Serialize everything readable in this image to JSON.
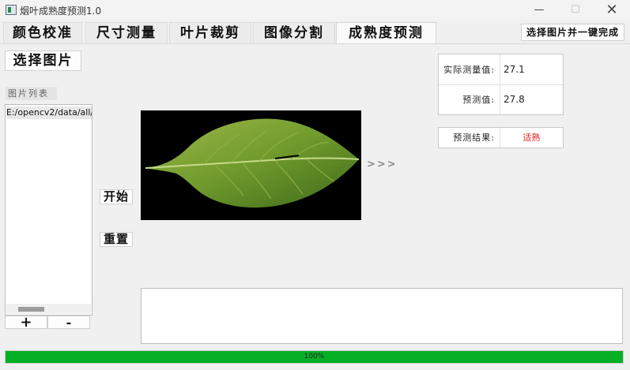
{
  "window": {
    "title": "烟叶成熟度预测1.0",
    "controls": {
      "minimize": "—",
      "maximize": "☐",
      "close": "✕"
    }
  },
  "tabs": [
    {
      "label": "颜色校准"
    },
    {
      "label": "尺寸测量"
    },
    {
      "label": "叶片裁剪"
    },
    {
      "label": "图像分割"
    },
    {
      "label": "成熟度预测",
      "active": true
    }
  ],
  "toolbar": {
    "one_click_label": "选择图片并一键完成"
  },
  "left_panel": {
    "select_image_label": "选择图片",
    "list_label": "图片列表",
    "list_items": [
      "E:/opencv2/data/all/"
    ],
    "add_label": "+",
    "remove_label": "-"
  },
  "actions": {
    "start_label": "开始",
    "reset_label": "重置"
  },
  "preview": {
    "arrow_text": ">>>",
    "icon": "leaf-image"
  },
  "measurements": {
    "actual_label": "实际测量值:",
    "actual_value": "27.1",
    "predicted_label": "预测值:",
    "predicted_value": "27.8"
  },
  "result": {
    "label": "预测结果:",
    "value": "适熟",
    "value_color": "#e02020"
  },
  "progress": {
    "percent": 100,
    "text": "100%",
    "color": "#06b025"
  },
  "output_box": {
    "text": ""
  }
}
